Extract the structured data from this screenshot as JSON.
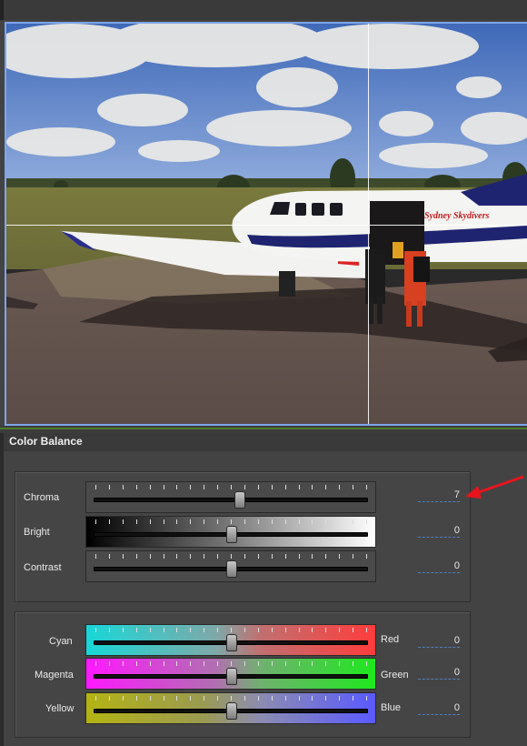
{
  "panel": {
    "title": "Color Balance"
  },
  "tone": [
    {
      "label": "Chroma",
      "value": "7",
      "position": 0.53
    },
    {
      "label": "Bright",
      "value": "0",
      "position": 0.5
    },
    {
      "label": "Contrast",
      "value": "0",
      "position": 0.5
    }
  ],
  "balance": [
    {
      "left": "Cyan",
      "right": "Red",
      "value": "0",
      "position": 0.5
    },
    {
      "left": "Magenta",
      "right": "Green",
      "value": "0",
      "position": 0.5
    },
    {
      "left": "Yellow",
      "right": "Blue",
      "value": "0",
      "position": 0.5
    }
  ],
  "preview": {
    "plane_text": "Sydney Skydivers"
  },
  "colors": {
    "accent_border": "#7fa6e8",
    "annotation_arrow": "#e8141e",
    "value_underline": "#4e7fc0"
  }
}
